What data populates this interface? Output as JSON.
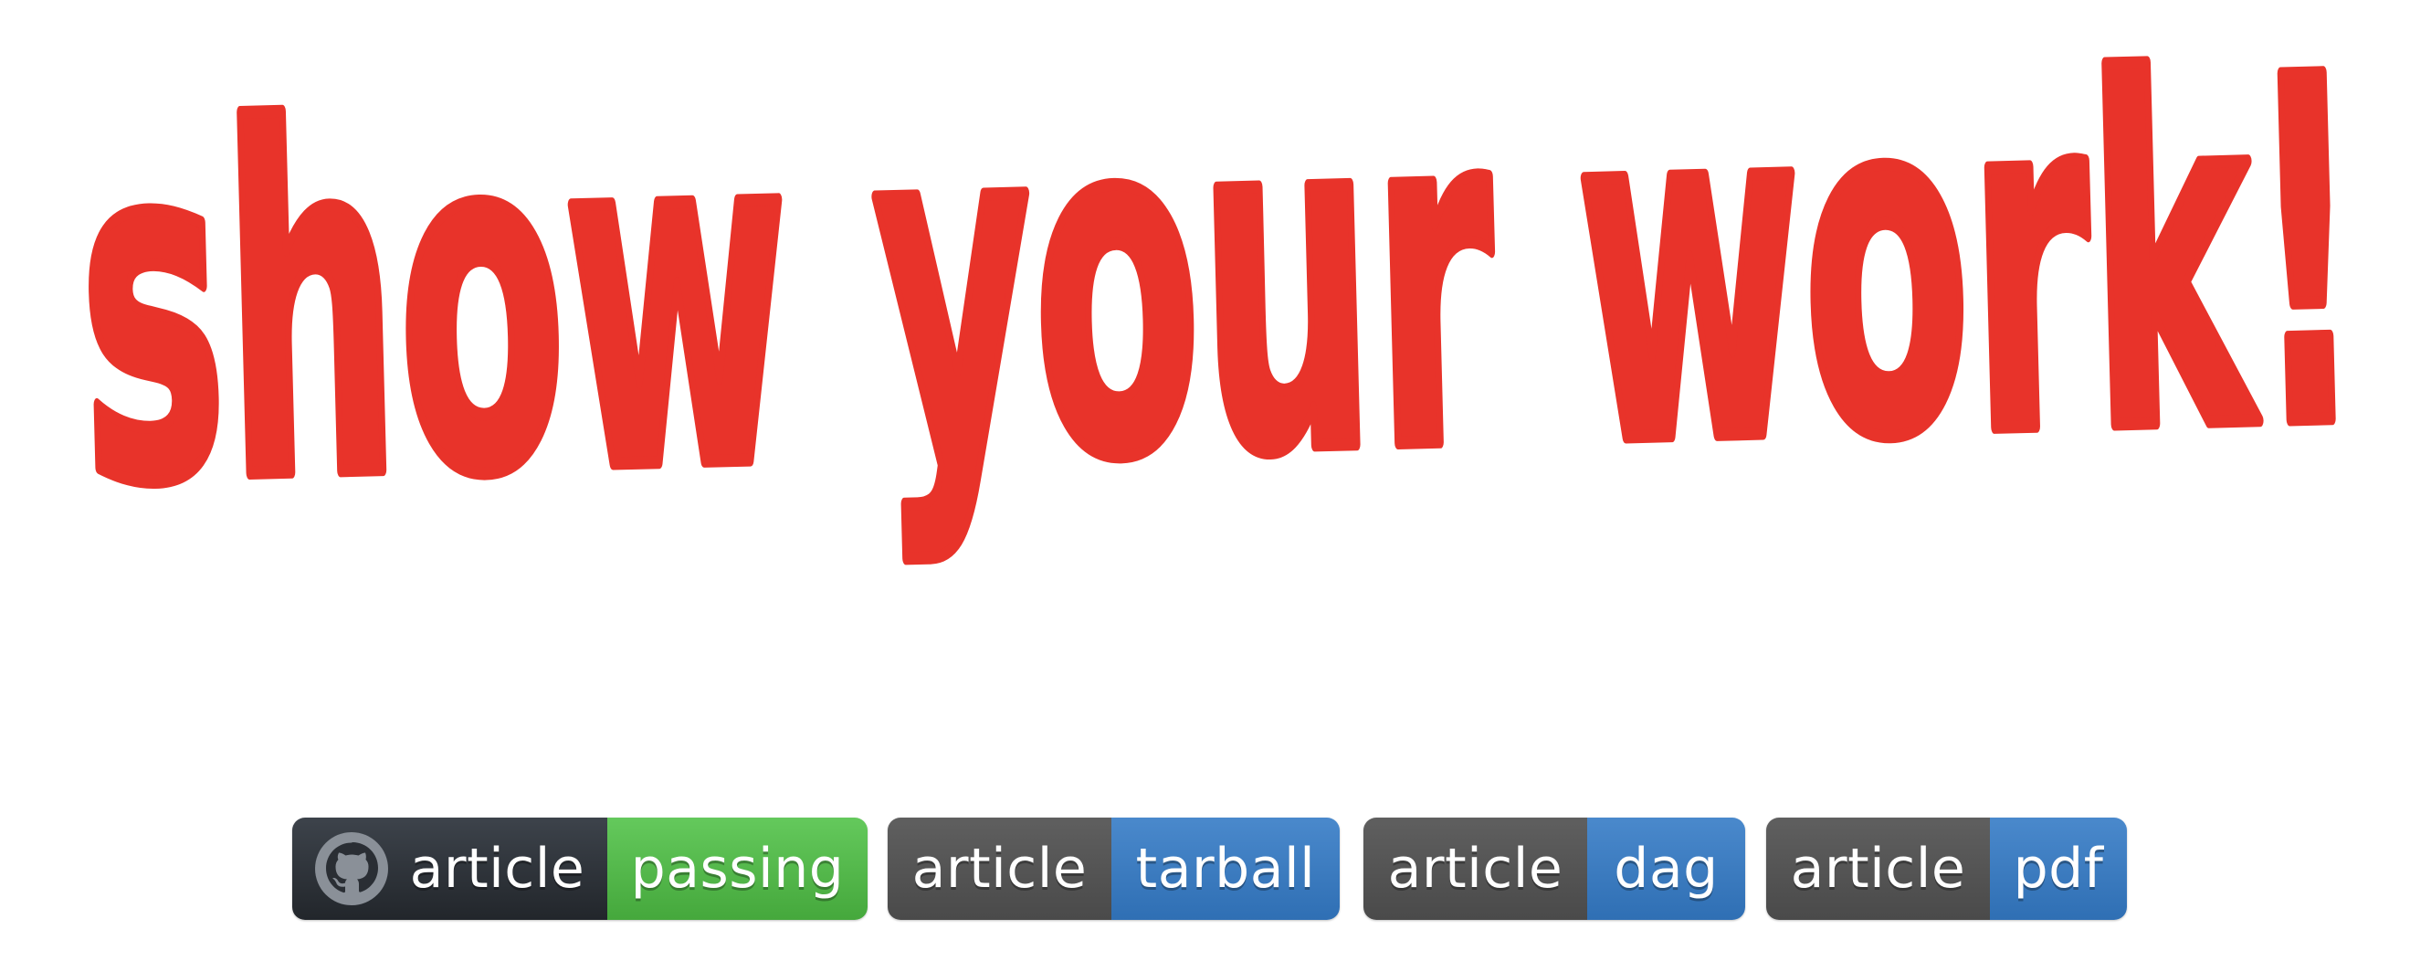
{
  "logo": {
    "text": "show your work!",
    "color": "#e8332a"
  },
  "badges": [
    {
      "label": "article",
      "message": "passing",
      "icon": "github-icon",
      "message_color": "#4cb944"
    },
    {
      "label": "article",
      "message": "tarball",
      "icon": "",
      "message_color": "#3a7bc0"
    },
    {
      "label": "article",
      "message": "dag",
      "icon": "",
      "message_color": "#3a7bc0"
    },
    {
      "label": "article",
      "message": "pdf",
      "icon": "",
      "message_color": "#3a7bc0"
    }
  ]
}
